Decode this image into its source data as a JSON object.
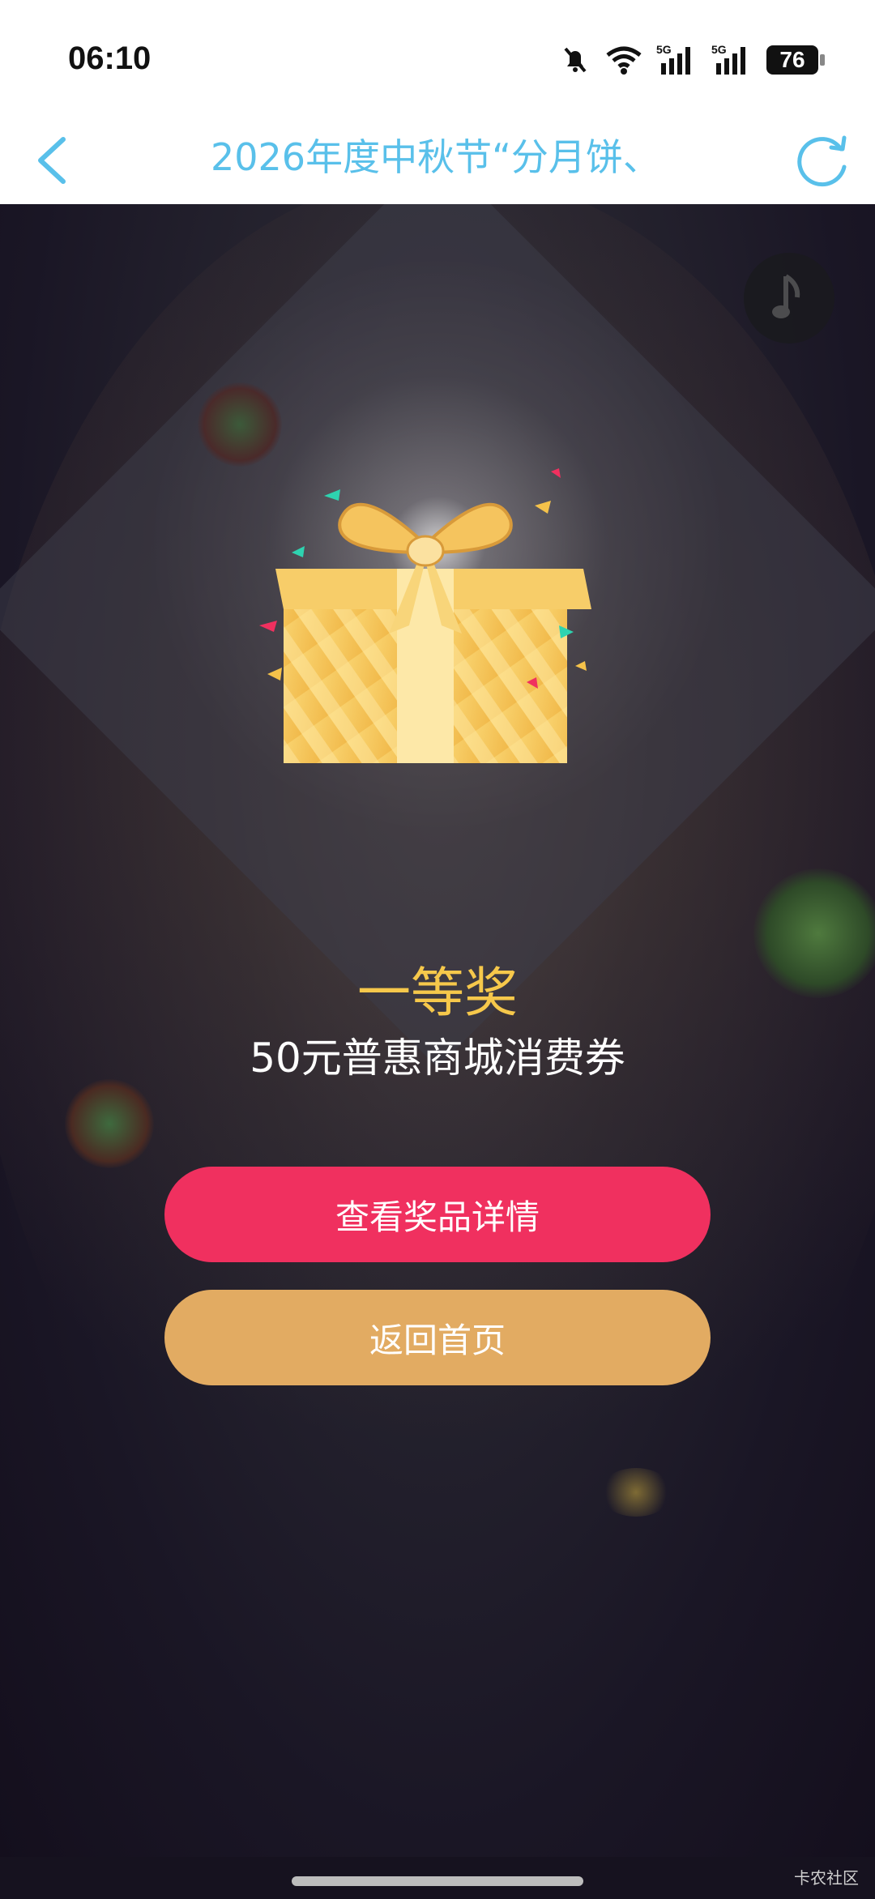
{
  "status_bar": {
    "time": "06:10",
    "battery": "76",
    "signal1_label": "5G",
    "signal2_label": "5G"
  },
  "nav": {
    "title": "2026年度中秋节“分月饼、"
  },
  "prize": {
    "level": "一等奖",
    "name": "50元普惠商城消费券"
  },
  "buttons": {
    "detail": "查看奖品详情",
    "home": "返回首页"
  },
  "watermark": "卡农社区",
  "colors": {
    "title_blue": "#59c0ea",
    "prize_gold": "#f6c84b",
    "detail_button": "#f0305f",
    "home_button": "#e2ab62"
  }
}
